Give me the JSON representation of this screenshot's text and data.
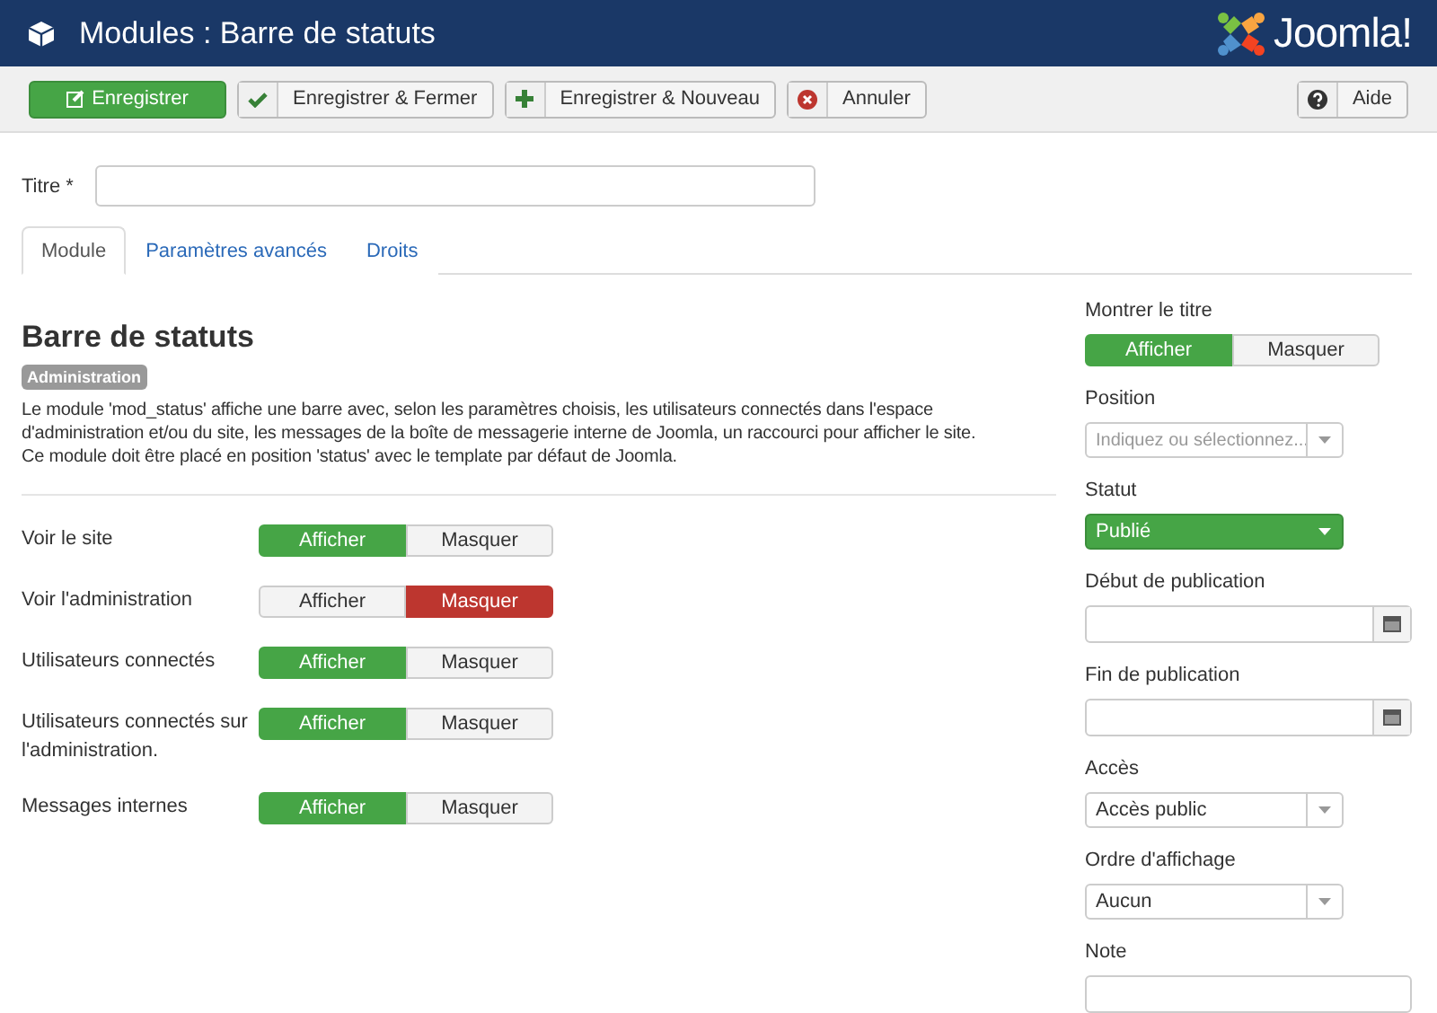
{
  "header": {
    "title": "Modules : Barre de statuts",
    "brand": "Joomla!"
  },
  "toolbar": [
    {
      "kind": "save",
      "label": "Enregistrer"
    },
    {
      "kind": "save-close",
      "label": "Enregistrer & Fermer"
    },
    {
      "kind": "save-new",
      "label": "Enregistrer & Nouveau"
    },
    {
      "kind": "cancel",
      "label": "Annuler"
    },
    {
      "kind": "help",
      "label": "Aide"
    }
  ],
  "title_field": {
    "label": "Titre *"
  },
  "tabs": [
    {
      "label": "Module",
      "selected": true
    },
    {
      "label": "Paramètres avancés",
      "selected": false
    },
    {
      "label": "Droits",
      "selected": false
    }
  ],
  "module": {
    "heading": "Barre de statuts",
    "badge": "Administration",
    "description": [
      "Le module 'mod_status' affiche une barre avec, selon les paramètres choisis, les utilisateurs connectés dans l'espace d'administration et/ou du site, les messages de la boîte de messagerie interne de Joomla, un raccourci pour afficher le site.",
      "Ce module doit être placé en position 'status' avec le template par défaut de Joomla."
    ]
  },
  "settings": [
    {
      "label": "Voir le site",
      "options": [
        {
          "label": "Afficher",
          "kind": "yes",
          "selected": true
        },
        {
          "label": "Masquer",
          "kind": "no",
          "selected": false
        }
      ]
    },
    {
      "label": "Voir l'administration",
      "options": [
        {
          "label": "Afficher",
          "kind": "yes",
          "selected": false
        },
        {
          "label": "Masquer",
          "kind": "no",
          "selected": true
        }
      ]
    },
    {
      "label": "Utilisateurs connectés",
      "options": [
        {
          "label": "Afficher",
          "kind": "yes",
          "selected": true
        },
        {
          "label": "Masquer",
          "kind": "no",
          "selected": false
        }
      ]
    },
    {
      "label": "Utilisateurs connectés sur l'administration.",
      "options": [
        {
          "label": "Afficher",
          "kind": "yes",
          "selected": true
        },
        {
          "label": "Masquer",
          "kind": "no",
          "selected": false
        }
      ]
    },
    {
      "label": "Messages internes",
      "options": [
        {
          "label": "Afficher",
          "kind": "yes",
          "selected": true
        },
        {
          "label": "Masquer",
          "kind": "no",
          "selected": false
        }
      ]
    }
  ],
  "sidebar": [
    {
      "kind": "toggle",
      "label": "Montrer le titre",
      "options": [
        {
          "label": "Afficher",
          "kind": "yes",
          "selected": true
        },
        {
          "label": "Masquer",
          "kind": "no",
          "selected": false
        }
      ]
    },
    {
      "kind": "select",
      "label": "Position",
      "placeholder": "Indiquez ou sélectionnez..."
    },
    {
      "kind": "status",
      "label": "Statut",
      "value": "Publié"
    },
    {
      "kind": "date",
      "label": "Début de publication"
    },
    {
      "kind": "date",
      "label": "Fin de publication"
    },
    {
      "kind": "select",
      "label": "Accès",
      "value": "Accès public"
    },
    {
      "kind": "select",
      "label": "Ordre d'affichage",
      "value": "Aucun"
    },
    {
      "kind": "text",
      "label": "Note"
    }
  ]
}
